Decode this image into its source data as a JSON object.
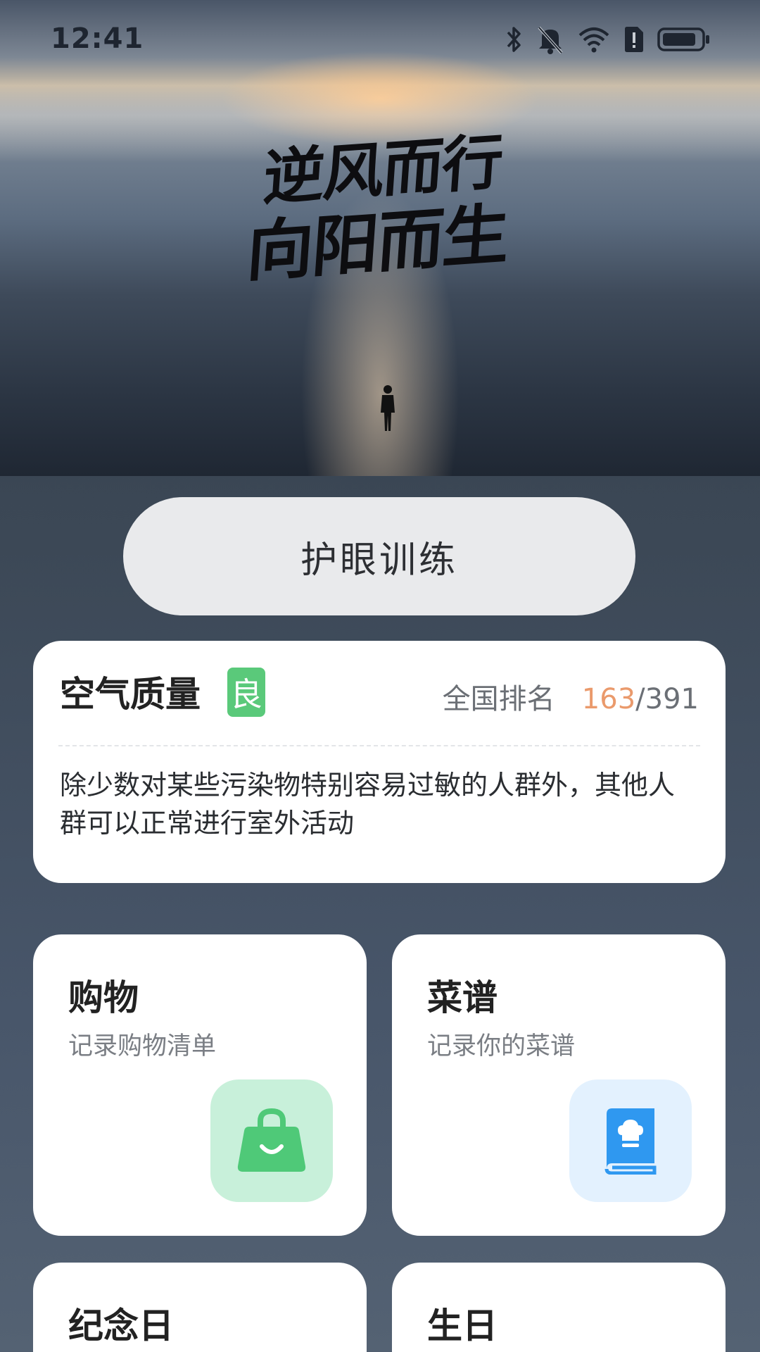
{
  "status_bar": {
    "time": "12:41",
    "icons": [
      "bluetooth-icon",
      "mute-icon",
      "wifi-icon",
      "sim-alert-icon",
      "battery-icon"
    ]
  },
  "hero": {
    "line1": "逆风而行",
    "line2": "向阳而生"
  },
  "eye_training": {
    "label": "护眼训练"
  },
  "air_quality": {
    "title": "空气质量",
    "grade": "良",
    "rank_label": "全国排名",
    "rank": "163",
    "rank_separator": "/",
    "rank_total": "391",
    "description": "除少数对某些污染物特别容易过敏的人群外，其他人群可以正常进行室外活动",
    "colors": {
      "grade_badge": "#5ac97a",
      "rank_highlight": "#ea9a6c"
    }
  },
  "tiles": [
    {
      "title": "购物",
      "subtitle": "记录购物清单",
      "icon": "shopping-bag-icon",
      "icon_color": "#4fc978",
      "icon_bg": "#c8f0da"
    },
    {
      "title": "菜谱",
      "subtitle": "记录你的菜谱",
      "icon": "recipe-book-icon",
      "icon_color": "#2f98f0",
      "icon_bg": "#e3f1fe"
    },
    {
      "title": "纪念日"
    },
    {
      "title": "生日"
    }
  ]
}
